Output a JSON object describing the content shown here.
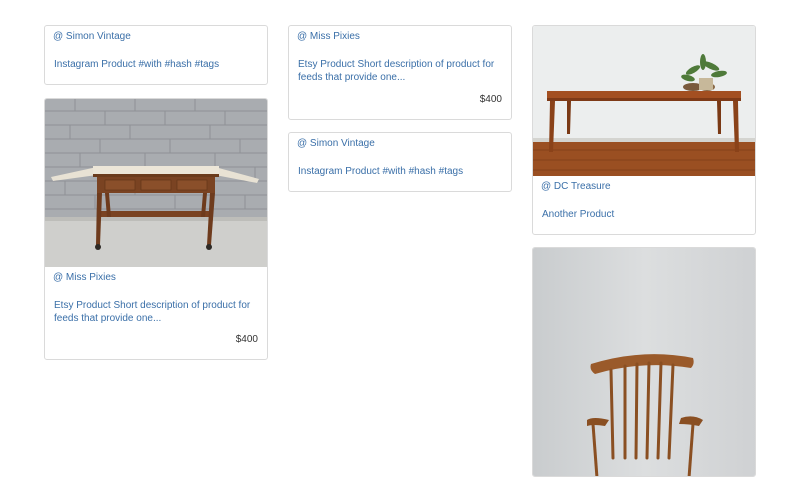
{
  "feed": {
    "cards": [
      {
        "source": "@ Simon Vintage",
        "description": "Instagram Product #with #hash #tags"
      },
      {
        "source": "@ Miss Pixies",
        "description": "Etsy Product Short description of product for feeds that provide one...",
        "price": "$400",
        "image": "folding-serving-cart-photo"
      },
      {
        "source": "@ Miss Pixies",
        "description": "Etsy Product Short description of product for feeds that provide one...",
        "price": "$400"
      },
      {
        "source": "@ Simon Vintage",
        "description": "Instagram Product #with #hash #tags"
      },
      {
        "source": "@ DC Treasure",
        "description": "Another Product",
        "image": "teak-bench-with-plant-photo"
      },
      {
        "image": "wooden-spindle-chair-photo"
      }
    ]
  },
  "colors": {
    "link": "#3a6fa8",
    "price": "#333333",
    "border": "#dadada"
  }
}
